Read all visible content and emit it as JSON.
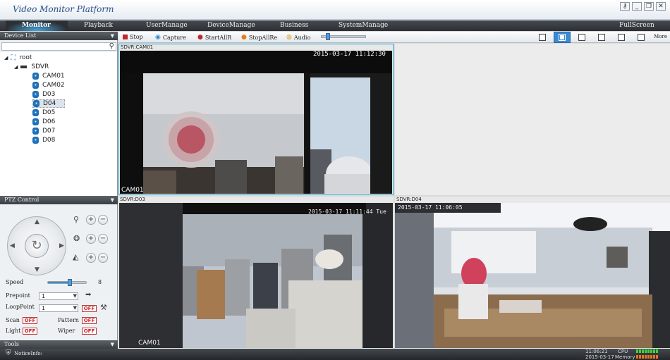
{
  "app": {
    "title": "Video Monitor Platform"
  },
  "window_controls": [
    "key-icon",
    "minimize-icon",
    "restore-icon",
    "close-icon"
  ],
  "menu": {
    "items": [
      "Monitor",
      "Playback",
      "UserManage",
      "DeviceManage",
      "Business",
      "SystemManage",
      "FullScreen"
    ],
    "active": "Monitor"
  },
  "device_list": {
    "title": "Device List",
    "search_placeholder": "",
    "root": "root",
    "group": "SDVR",
    "items": [
      "CAM01",
      "CAM02",
      "D03",
      "D04",
      "D05",
      "D06",
      "D07",
      "D08"
    ],
    "selected": "D04"
  },
  "ptz": {
    "title": "PTZ Control",
    "speed_label": "Speed",
    "speed_value": "8",
    "speed_fraction": 0.57,
    "prepoint_label": "Prepoint",
    "prepoint_value": "1",
    "loop_label": "LoopPoint",
    "loop_value": "1",
    "off": "OFF",
    "scan_label": "Scan",
    "pattern_label": "Pattern",
    "light_label": "Light",
    "wiper_label": "Wiper"
  },
  "tools": {
    "title": "Tools"
  },
  "toolbar": {
    "stop": "Stop",
    "capture": "Capture",
    "start_all": "StartAllR",
    "stop_all": "StopAllRe",
    "audio": "Audio",
    "audio_level": 0.1,
    "more": "More"
  },
  "video": {
    "pane1": {
      "label": "SDVR:CAM01",
      "time": "2015-03-17 11:12:30",
      "name": "CAM01"
    },
    "pane3": {
      "label": "SDVR:D03",
      "time": "2015-03-17 11:11:44 Tue",
      "name": "CAM01"
    },
    "pane4": {
      "label": "SDVR:D04",
      "time": "2015-03-17 11:06:05"
    }
  },
  "status": {
    "notice": "NoticeInfo:",
    "time": "11:06:21",
    "date": "2015-03-17",
    "cpu_label": "CPU",
    "mem_label": "Memory",
    "colors": {
      "cpu": "#3cd23c",
      "mem": "#e8741c"
    }
  }
}
